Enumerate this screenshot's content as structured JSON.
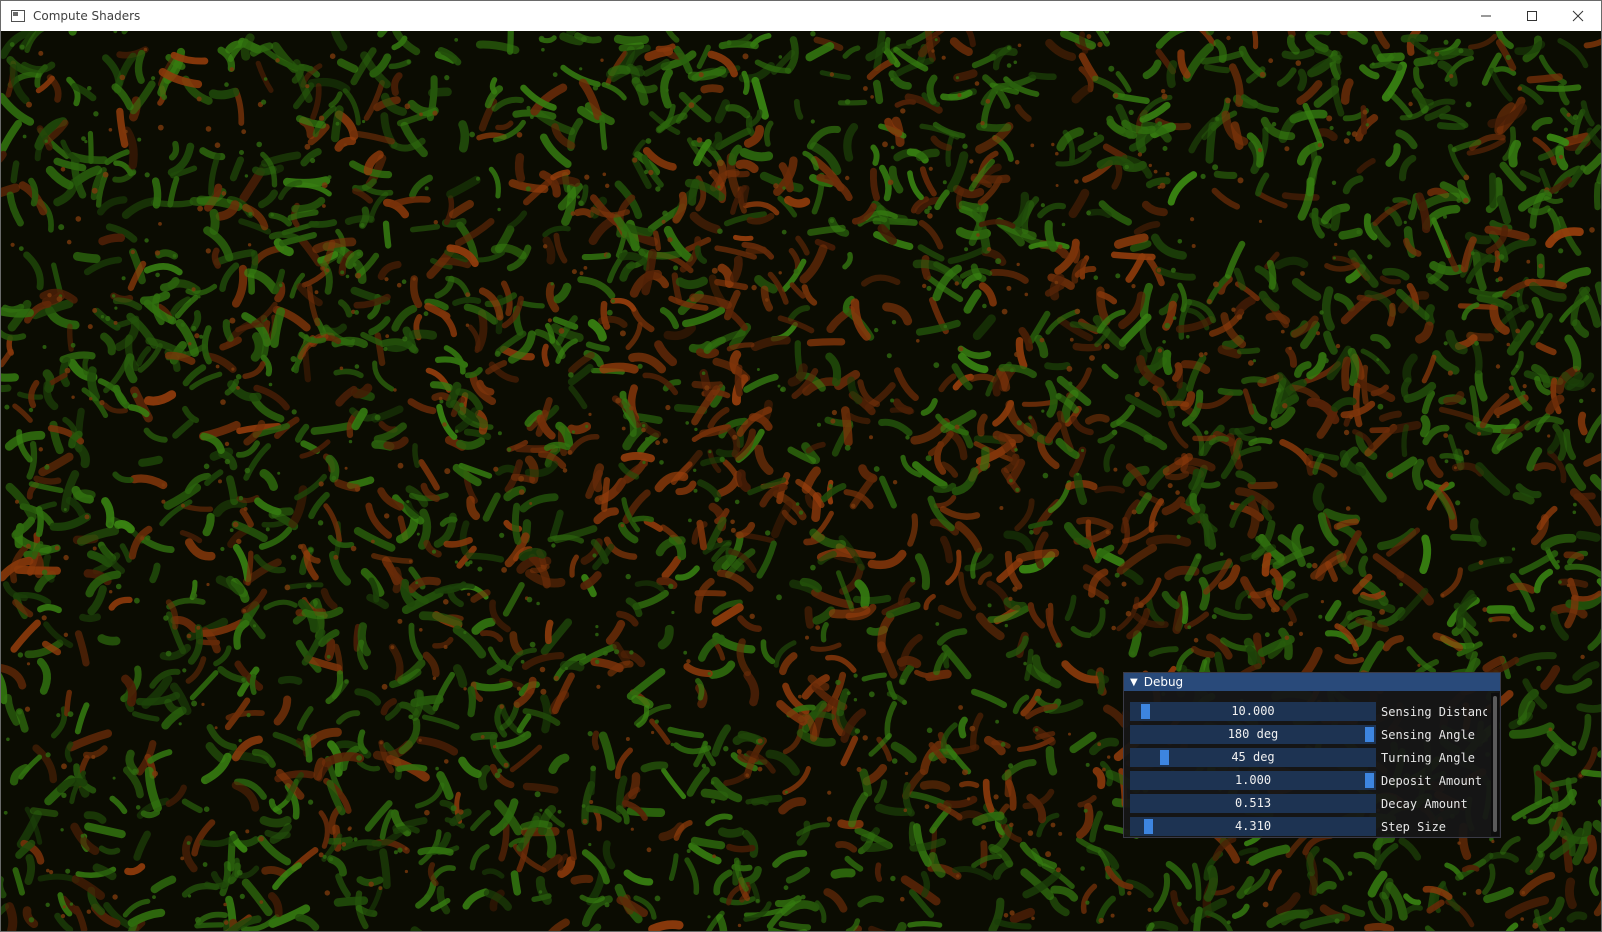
{
  "window": {
    "title": "Compute Shaders",
    "controls": [
      "minimize-icon",
      "maximize-icon",
      "close-icon"
    ]
  },
  "debug": {
    "header": "Debug",
    "rows": [
      {
        "value_text": "10.000",
        "label": "Sensing Distanc",
        "fraction": 0.04
      },
      {
        "value_text": "180 deg",
        "label": "Sensing Angle",
        "fraction": 1.0
      },
      {
        "value_text": "45 deg",
        "label": "Turning Angle",
        "fraction": 0.12
      },
      {
        "value_text": "1.000",
        "label": "Deposit Amount",
        "fraction": 1.0
      },
      {
        "value_text": "0.513",
        "label": "Decay Amount",
        "fraction": null
      },
      {
        "value_text": "4.310",
        "label": "Step Size",
        "fraction": 0.05
      }
    ]
  },
  "colors": {
    "header": "#294a7a",
    "slider_bg": "#1d3352",
    "grab": "#3d85e0",
    "sim_green": "#3f8f12",
    "sim_orange": "#a4420c"
  }
}
